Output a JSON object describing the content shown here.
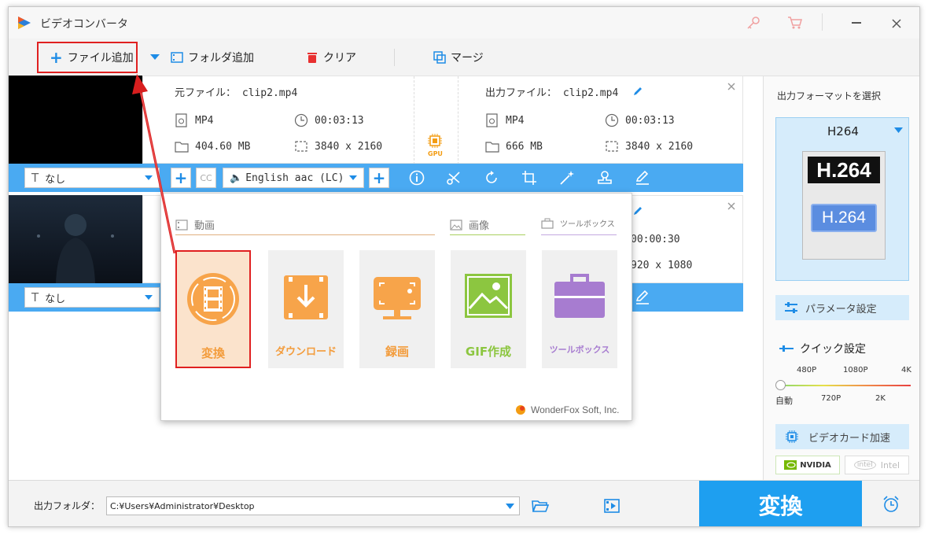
{
  "app": {
    "title": "ビデオコンバータ"
  },
  "toolbar": {
    "add_file": "ファイル追加",
    "add_folder": "フォルダ追加",
    "clear": "クリア",
    "merge": "マージ"
  },
  "file1": {
    "source_label": "元ファイル： clip2.mp4",
    "output_label": "出力ファイル： clip2.mp4",
    "src_format": "MP4",
    "src_duration": "00:03:13",
    "src_size": "404.60 MB",
    "src_resolution": "3840 x 2160",
    "out_format": "MP4",
    "out_duration": "00:03:13",
    "out_size": "666 MB",
    "out_resolution": "3840 x 2160",
    "gpu_label": "GPU",
    "subtitle": "なし",
    "audio": "English aac (LC)",
    "cc_label": "CC"
  },
  "file2": {
    "subtitle": "なし",
    "out_duration": "00:00:30",
    "out_resolution": "920 x 1080"
  },
  "popup": {
    "section_video": "動画",
    "section_image": "画像",
    "section_toolbox": "ツールボックス",
    "tiles": [
      {
        "label": "変換"
      },
      {
        "label": "ダウンロード"
      },
      {
        "label": "録画"
      },
      {
        "label": "GIF作成"
      },
      {
        "label": "ツールボックス"
      }
    ],
    "brand": "WonderFox Soft, Inc."
  },
  "sidebar": {
    "title": "出力フォーマットを選択",
    "format": "H264",
    "format_big": "H.264",
    "format_small": "H.264",
    "param_button": "パラメータ設定",
    "quick_title": "クイック設定",
    "quality_top": [
      "480P",
      "1080P",
      "4K"
    ],
    "quality_bottom": [
      "自動",
      "720P",
      "2K"
    ],
    "quality_selected": 0,
    "gpu_button": "ビデオカード加速",
    "nvidia": "NVIDIA",
    "intel": "Intel"
  },
  "bottom": {
    "output_label": "出力フォルダ：",
    "output_path": "C:¥Users¥Administrator¥Desktop",
    "convert": "変換"
  },
  "colors": {
    "accent_blue": "#1e9ff0",
    "toolbar_blue": "#4aaaf2",
    "orange": "#f7a44a",
    "green": "#8cc640",
    "purple": "#a77cd0",
    "red_highlight": "#e02020"
  }
}
